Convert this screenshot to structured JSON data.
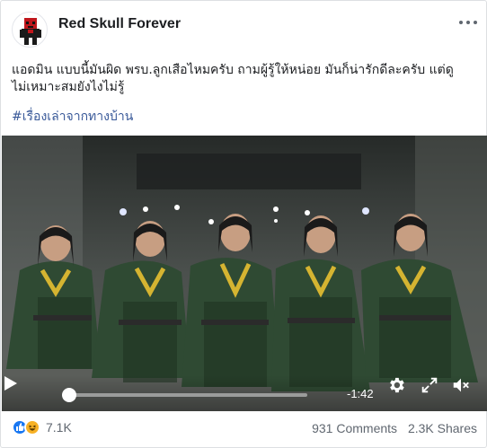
{
  "post": {
    "page_name": "Red Skull Forever",
    "text_line1": "แอดมิน แบบนี้มันผิด พรบ.ลูกเสือไหมครับ ถามผู้รู้ให้หน่อย มันก็น่ารักดีละครับ แต่ดู",
    "text_line2": "ไม่เหมาะสมยังไงไม่รู้",
    "hashtag": "#เรื่องเล่าจากทางบ้าน"
  },
  "video": {
    "time_remaining": "-1:42",
    "progress": 0.02
  },
  "icons": {
    "avatar": "red-skull-pixel-avatar",
    "more": "more-options-icon",
    "play": "play-icon",
    "settings": "gear-icon",
    "fullscreen": "expand-icon",
    "volume": "volume-muted-icon",
    "like": "like-reaction-icon",
    "haha": "haha-reaction-icon"
  },
  "footer": {
    "reaction_count": "7.1K",
    "comments": "931 Comments",
    "shares": "2.3K Shares"
  },
  "colors": {
    "accent_link": "#385898",
    "like_blue": "#1877f2",
    "haha_yellow": "#f7b125"
  }
}
